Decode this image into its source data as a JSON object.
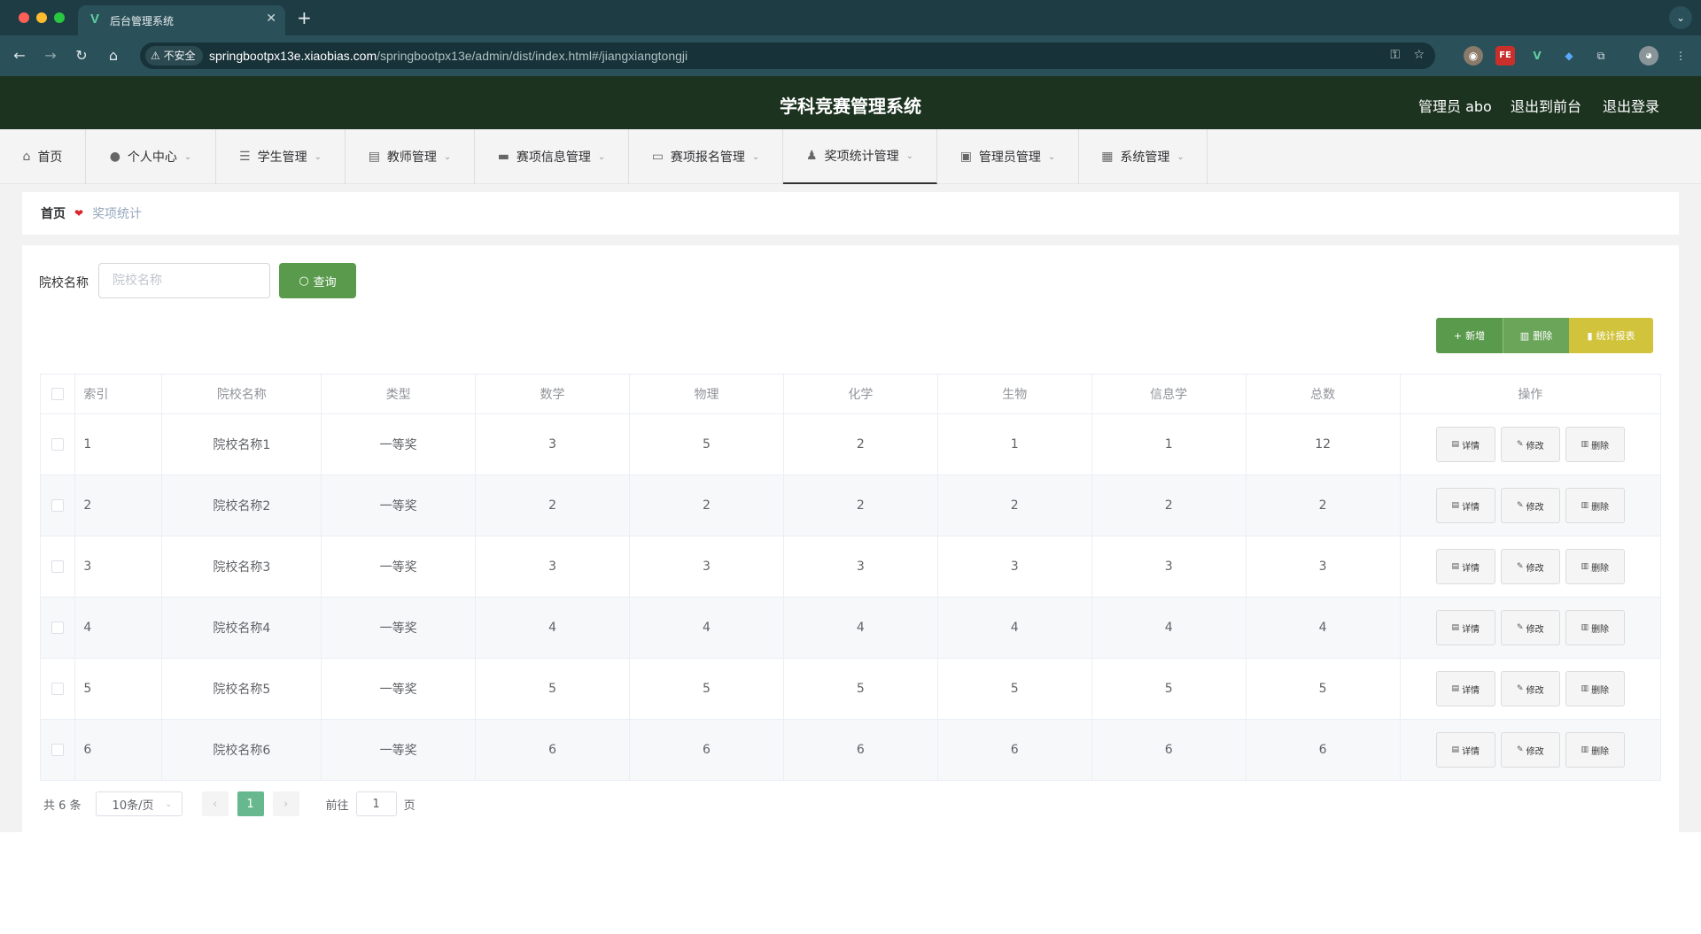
{
  "browser": {
    "tab_title": "后台管理系统",
    "url_warning": "不安全",
    "url_host": "springbootpx13e.xiaobias.com",
    "url_path": "/springbootpx13e/admin/dist/index.html#/jiangxiangtongji"
  },
  "header": {
    "title": "学科竞赛管理系统",
    "user": "管理员 abo",
    "to_front": "退出到前台",
    "logout": "退出登录"
  },
  "menu": [
    {
      "label": "首页",
      "icon": "home-icon"
    },
    {
      "label": "个人中心",
      "icon": "user-icon"
    },
    {
      "label": "学生管理",
      "icon": "list-icon"
    },
    {
      "label": "教师管理",
      "icon": "calendar-icon"
    },
    {
      "label": "赛项信息管理",
      "icon": "monitor-icon"
    },
    {
      "label": "赛项报名管理",
      "icon": "card-icon"
    },
    {
      "label": "奖项统计管理",
      "icon": "person-icon"
    },
    {
      "label": "管理员管理",
      "icon": "chart-icon"
    },
    {
      "label": "系统管理",
      "icon": "cabinet-icon"
    }
  ],
  "breadcrumb": {
    "home": "首页",
    "current": "奖项统计"
  },
  "search": {
    "label": "院校名称",
    "placeholder": "院校名称",
    "button": "查询"
  },
  "toolbar": {
    "add": "新增",
    "delete": "删除",
    "report": "统计报表"
  },
  "table": {
    "columns": [
      "索引",
      "院校名称",
      "类型",
      "数学",
      "物理",
      "化学",
      "生物",
      "信息学",
      "总数",
      "操作"
    ],
    "rows": [
      [
        "1",
        "院校名称1",
        "一等奖",
        "3",
        "5",
        "2",
        "1",
        "1",
        "12"
      ],
      [
        "2",
        "院校名称2",
        "一等奖",
        "2",
        "2",
        "2",
        "2",
        "2",
        "2"
      ],
      [
        "3",
        "院校名称3",
        "一等奖",
        "3",
        "3",
        "3",
        "3",
        "3",
        "3"
      ],
      [
        "4",
        "院校名称4",
        "一等奖",
        "4",
        "4",
        "4",
        "4",
        "4",
        "4"
      ],
      [
        "5",
        "院校名称5",
        "一等奖",
        "5",
        "5",
        "5",
        "5",
        "5",
        "5"
      ],
      [
        "6",
        "院校名称6",
        "一等奖",
        "6",
        "6",
        "6",
        "6",
        "6",
        "6"
      ]
    ],
    "actions": {
      "detail": "详情",
      "edit": "修改",
      "delete": "删除"
    }
  },
  "pagination": {
    "total": "共 6 条",
    "page_size": "10条/页",
    "current": "1",
    "goto_prefix": "前往",
    "goto_value": "1",
    "goto_suffix": "页"
  }
}
